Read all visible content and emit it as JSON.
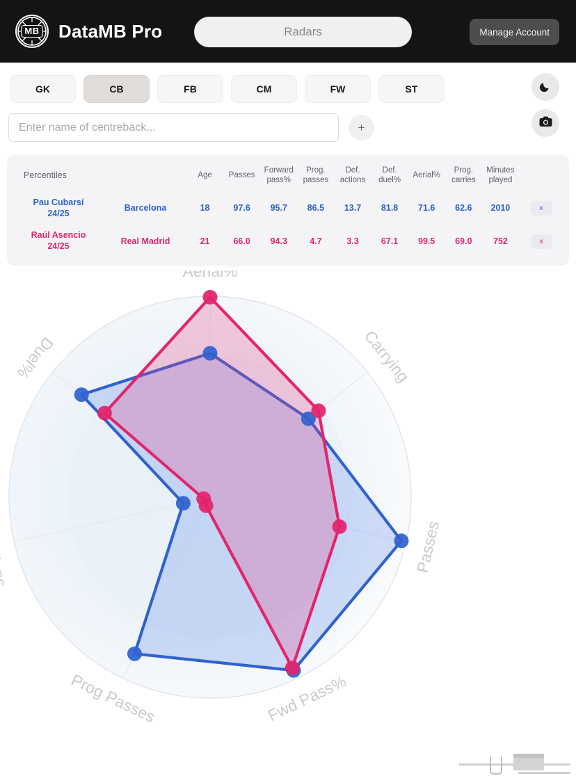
{
  "header": {
    "logo_text": "MB",
    "brand": "DataMB Pro",
    "page_pill": "Radars",
    "manage_account": "Manage Account",
    "logo_icon": "football-ball-icon"
  },
  "position_tabs": [
    {
      "label": "GK",
      "active": false
    },
    {
      "label": "CB",
      "active": true
    },
    {
      "label": "FB",
      "active": false
    },
    {
      "label": "CM",
      "active": false
    },
    {
      "label": "FW",
      "active": false
    },
    {
      "label": "ST",
      "active": false
    }
  ],
  "search": {
    "placeholder": "Enter name of centreback...",
    "value": "",
    "add_label": "+"
  },
  "side_buttons": {
    "theme_icon": "moon-icon",
    "camera_icon": "camera-icon"
  },
  "table": {
    "headers": [
      "Percentiles",
      "",
      "Age",
      "Passes",
      "Forward pass%",
      "Prog. passes",
      "Def. actions",
      "Def. duel%",
      "Aerial%",
      "Prog. carries",
      "Minutes played",
      ""
    ],
    "headers_multiline": [
      [
        "Percentiles"
      ],
      [
        ""
      ],
      [
        "Age"
      ],
      [
        "Passes"
      ],
      [
        "Forward",
        "pass%"
      ],
      [
        "Prog.",
        "passes"
      ],
      [
        "Def.",
        "actions"
      ],
      [
        "Def.",
        "duel%"
      ],
      [
        "Aerial%"
      ],
      [
        "Prog.",
        "carries"
      ],
      [
        "Minutes",
        "played"
      ],
      [
        ""
      ]
    ],
    "rows": [
      {
        "player": "Pau Cubarsí",
        "season": "24/25",
        "team": "Barcelona",
        "age": "18",
        "passes": "97.6",
        "forward_pass_pct": "95.7",
        "prog_passes": "86.5",
        "def_actions": "13.7",
        "def_duel_pct": "81.8",
        "aerial_pct": "71.6",
        "prog_carries": "62.6",
        "minutes_played": "2010",
        "remove_label": "x",
        "color": "#2f62cf"
      },
      {
        "player": "Raúl Asencio",
        "season": "24/25",
        "team": "Real Madrid",
        "age": "21",
        "passes": "66.0",
        "forward_pass_pct": "94.3",
        "prog_passes": "4.7",
        "def_actions": "3.3",
        "def_duel_pct": "67.1",
        "aerial_pct": "99.5",
        "prog_carries": "69.0",
        "minutes_played": "752",
        "remove_label": "x",
        "color": "#e2256d"
      }
    ]
  },
  "chart_data": {
    "type": "radar",
    "title": "",
    "axes": [
      "Aerial%",
      "Carrying",
      "Passes",
      "Fwd Pass%",
      "Prog Passes",
      "Def Actions",
      "Duel%"
    ],
    "axis_label_names": [
      "Aerial%",
      "Carrying",
      "Passes",
      "Fwd Pass%",
      "Prog Passes",
      "Def Actions",
      "Duel%"
    ],
    "rmin": 0,
    "rmax": 100,
    "grid": true,
    "legend": "none",
    "series": [
      {
        "name": "Pau Cubarsí 24/25",
        "color": "#2f62cf",
        "fill": "rgba(110,150,235,0.30)",
        "values": [
          71.6,
          62.6,
          97.6,
          95.7,
          86.5,
          13.7,
          81.8
        ]
      },
      {
        "name": "Raúl Asencio 24/25",
        "color": "#e2256d",
        "fill": "rgba(232,60,130,0.26)",
        "values": [
          99.5,
          69.0,
          66.0,
          94.3,
          4.7,
          3.3,
          67.1
        ]
      }
    ]
  },
  "colors": {
    "player1": "#2f62cf",
    "player2": "#e2256d",
    "header_bg": "#141414",
    "tab_active_bg": "#e0dcd9",
    "table_bg": "#f4f4f6"
  }
}
